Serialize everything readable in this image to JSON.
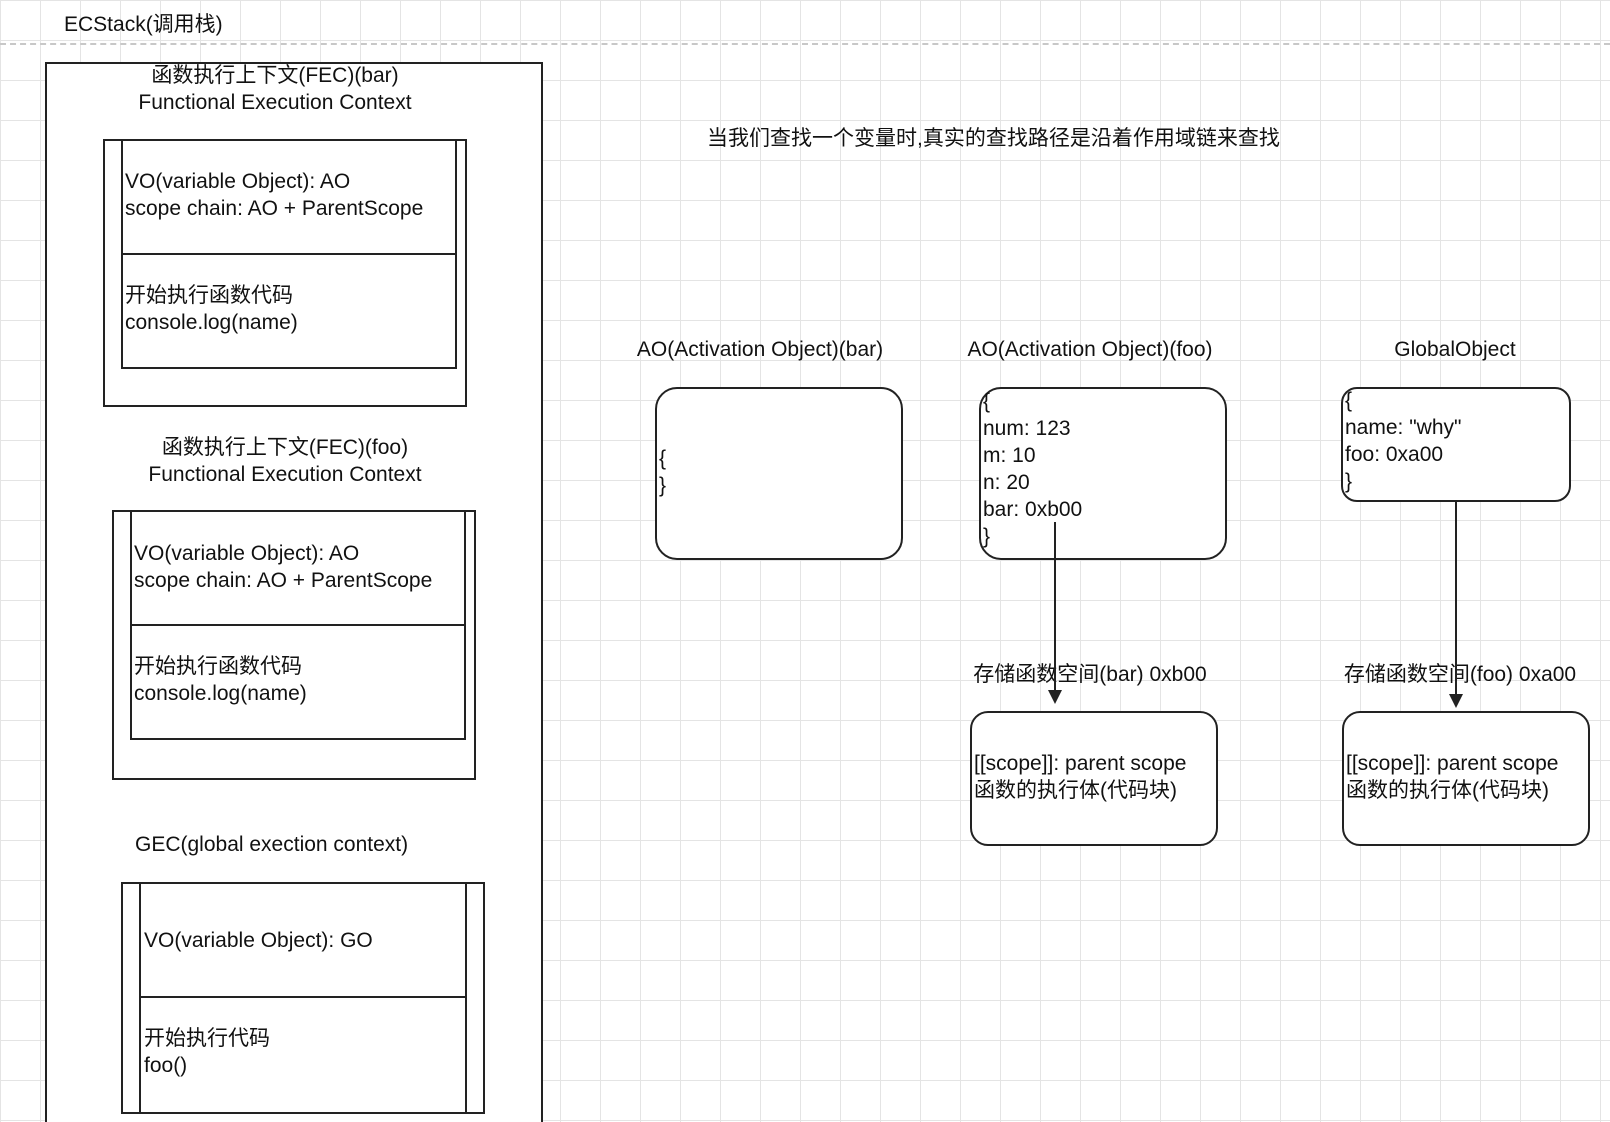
{
  "ecstack": {
    "title": "ECStack(调用栈)"
  },
  "fec_bar": {
    "title": "函数执行上下文(FEC)(bar)",
    "subtitle": "Functional Execution Context",
    "vo": "VO(variable Object): AO",
    "scope_chain": "scope chain: AO + ParentScope",
    "exec_label": "开始执行函数代码",
    "exec_code": "console.log(name)"
  },
  "fec_foo": {
    "title": "函数执行上下文(FEC)(foo)",
    "subtitle": "Functional Execution Context",
    "vo": "VO(variable Object): AO",
    "scope_chain": "scope chain: AO + ParentScope",
    "exec_label": "开始执行函数代码",
    "exec_code": "console.log(name)"
  },
  "gec": {
    "title": "GEC(global exection context)",
    "vo": "VO(variable Object): GO",
    "exec_label": "开始执行代码",
    "exec_code": "foo()"
  },
  "note": "当我们查找一个变量时,真实的查找路径是沿着作用域链来查找",
  "ao_bar": {
    "title": "AO(Activation Object)(bar)",
    "open": "{",
    "close": "}"
  },
  "ao_foo": {
    "title": "AO(Activation Object)(foo)",
    "open": "{",
    "num": "num: 123",
    "m": "m: 10",
    "n": "n: 20",
    "bar": "bar: 0xb00",
    "close": "}"
  },
  "global_object": {
    "title": "GlobalObject",
    "open": "{",
    "name": "name: \"why\"",
    "foo": "foo: 0xa00",
    "close": "}"
  },
  "func_bar": {
    "title": "存储函数空间(bar) 0xb00",
    "scope": "[[scope]]: parent scope",
    "body": "函数的执行体(代码块)"
  },
  "func_foo": {
    "title": "存储函数空间(foo) 0xa00",
    "scope": "[[scope]]: parent scope",
    "body": "函数的执行体(代码块)"
  }
}
